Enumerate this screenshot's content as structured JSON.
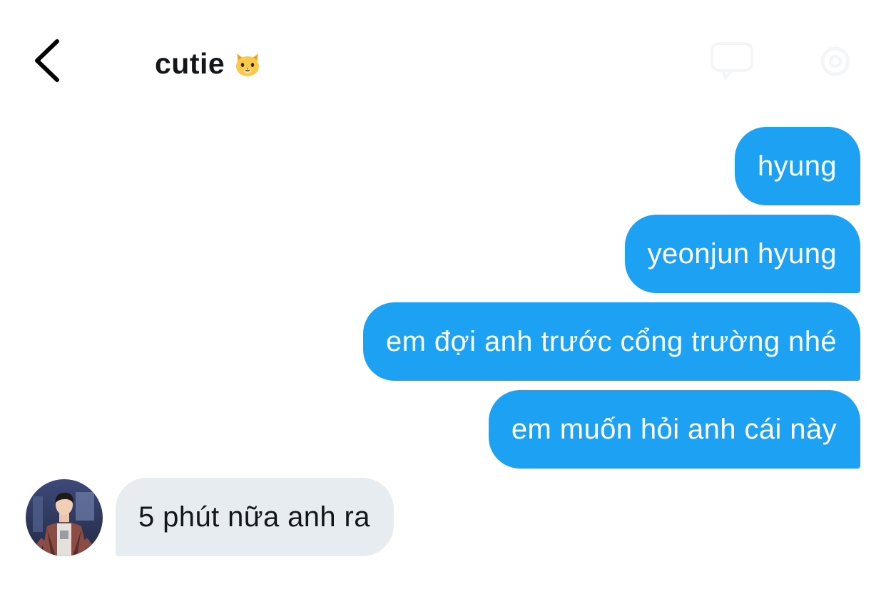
{
  "header": {
    "title": "cutie",
    "title_emoji": "cat-face-emoji"
  },
  "messages": [
    {
      "direction": "outgoing",
      "text": "hyung"
    },
    {
      "direction": "outgoing",
      "text": "yeonjun hyung"
    },
    {
      "direction": "outgoing",
      "text": "em đợi anh trước cổng trường nhé"
    },
    {
      "direction": "outgoing",
      "text": "em muốn hỏi anh cái này"
    },
    {
      "direction": "incoming",
      "text": "5 phút nữa anh ra"
    }
  ],
  "colors": {
    "outgoing_bubble": "#1da1f2",
    "incoming_bubble": "#e6ecf0",
    "outgoing_text": "#ffffff",
    "incoming_text": "#14171a"
  },
  "icons": {
    "back": "chevron-left-icon",
    "header_right_1": "chat-icon",
    "header_right_2": "settings-icon"
  }
}
